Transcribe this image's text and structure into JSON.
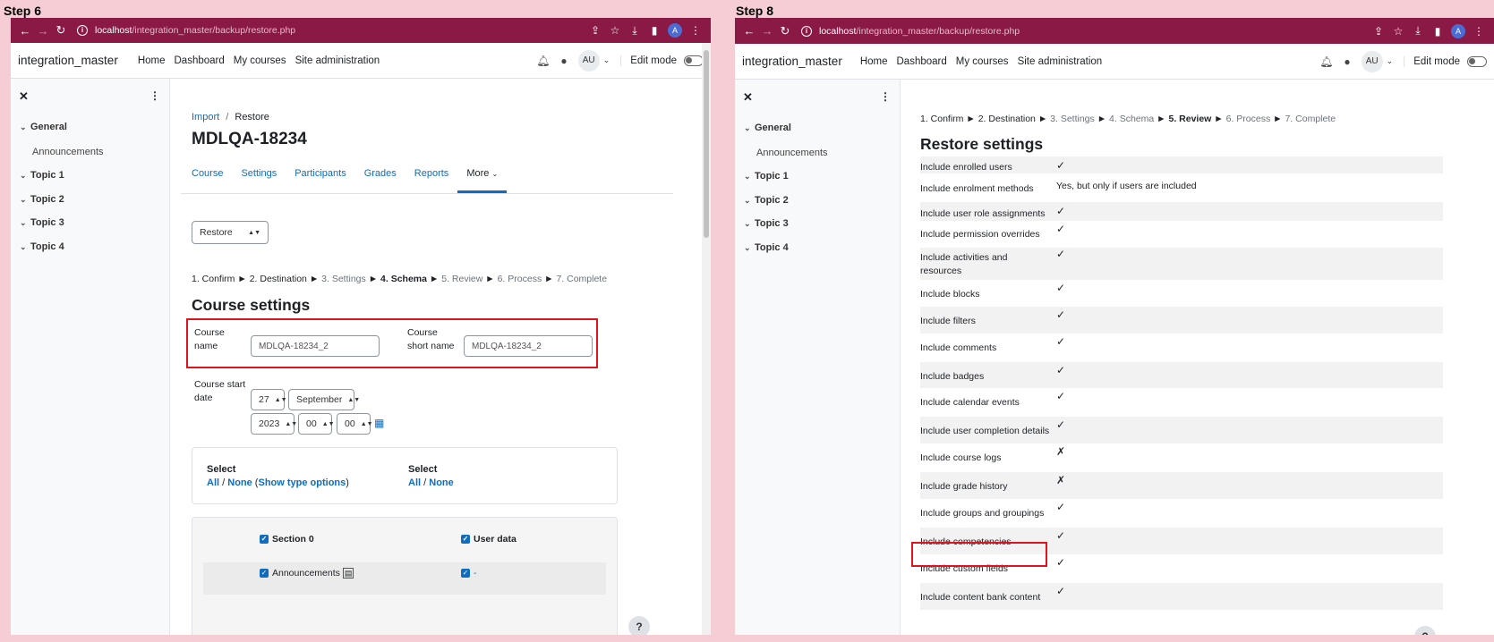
{
  "left": {
    "step_label": "Step 6",
    "browser": {
      "host": "localhost",
      "path": "/integration_master/backup/restore.php"
    },
    "navbar": {
      "brand": "integration_master",
      "links": [
        "Home",
        "Dashboard",
        "My courses",
        "Site administration"
      ],
      "avatar": "AU",
      "edit_mode": "Edit mode"
    },
    "drawer": {
      "sections": [
        "General",
        "Topic 1",
        "Topic 2",
        "Topic 3",
        "Topic 4"
      ],
      "sub": "Announcements"
    },
    "breadcrumb": {
      "link": "Import",
      "sep": "/",
      "current": "Restore"
    },
    "title": "MDLQA-18234",
    "tabs": [
      "Course",
      "Settings",
      "Participants",
      "Grades",
      "Reports",
      "More"
    ],
    "restore_select": "Restore",
    "steps": {
      "s1": "1. Confirm",
      "s2": "2. Destination",
      "s3": "3. Settings",
      "s4": "4. Schema",
      "s5": "5. Review",
      "s6": "6. Process",
      "s7": "7. Complete",
      "arrow": "►"
    },
    "heading": "Course settings",
    "course_name_label1": "Course",
    "course_name_label2": "name",
    "course_name_value": "MDLQA-18234_2",
    "short_name_label1": "Course",
    "short_name_label2": "short name",
    "short_name_value": "MDLQA-18234_2",
    "start_date_label1": "Course start",
    "start_date_label2": "date",
    "date": {
      "day": "27",
      "month": "September",
      "year": "2023",
      "hour": "00",
      "minute": "00"
    },
    "select_box": {
      "select1": "Select",
      "all": "All",
      "slash": "/",
      "none": "None",
      "show_types": "Show type options",
      "select2": "Select"
    },
    "rows": {
      "section0": "Section 0",
      "userdata": "User data",
      "announcements": "Announcements",
      "dash": "-"
    },
    "help": "?"
  },
  "right": {
    "step_label": "Step 8",
    "browser": {
      "host": "localhost",
      "path": "/integration_master/backup/restore.php"
    },
    "navbar": {
      "brand": "integration_master",
      "links": [
        "Home",
        "Dashboard",
        "My courses",
        "Site administration"
      ],
      "avatar": "AU",
      "edit_mode": "Edit mode"
    },
    "drawer": {
      "sections": [
        "General",
        "Topic 1",
        "Topic 2",
        "Topic 3",
        "Topic 4"
      ],
      "sub": "Announcements"
    },
    "steps": {
      "s1": "1. Confirm",
      "s2": "2. Destination",
      "s3": "3. Settings",
      "s4": "4. Schema",
      "s5": "5. Review",
      "s6": "6. Process",
      "s7": "7. Complete",
      "arrow": "►"
    },
    "heading": "Restore settings",
    "settings": [
      {
        "label": "Include enrolled users",
        "value": "✓"
      },
      {
        "label": "Include enrolment methods",
        "value": "Yes, but only if users are included"
      },
      {
        "label": "Include user role assignments",
        "value": "✓"
      },
      {
        "label": "Include permission overrides",
        "value": "✓"
      },
      {
        "label": "Include activities and resources",
        "value": "✓"
      },
      {
        "label": "Include blocks",
        "value": "✓"
      },
      {
        "label": "Include filters",
        "value": "✓"
      },
      {
        "label": "Include comments",
        "value": "✓"
      },
      {
        "label": "Include badges",
        "value": "✓"
      },
      {
        "label": "Include calendar events",
        "value": "✓"
      },
      {
        "label": "Include user completion details",
        "value": "✓"
      },
      {
        "label": "Include course logs",
        "value": "✗"
      },
      {
        "label": "Include grade history",
        "value": "✗"
      },
      {
        "label": "Include groups and groupings",
        "value": "✓"
      },
      {
        "label": "Include competencies",
        "value": "✓"
      },
      {
        "label": "Include custom fields",
        "value": "✓"
      },
      {
        "label": "Include content bank content",
        "value": "✓"
      }
    ],
    "help": "?"
  }
}
